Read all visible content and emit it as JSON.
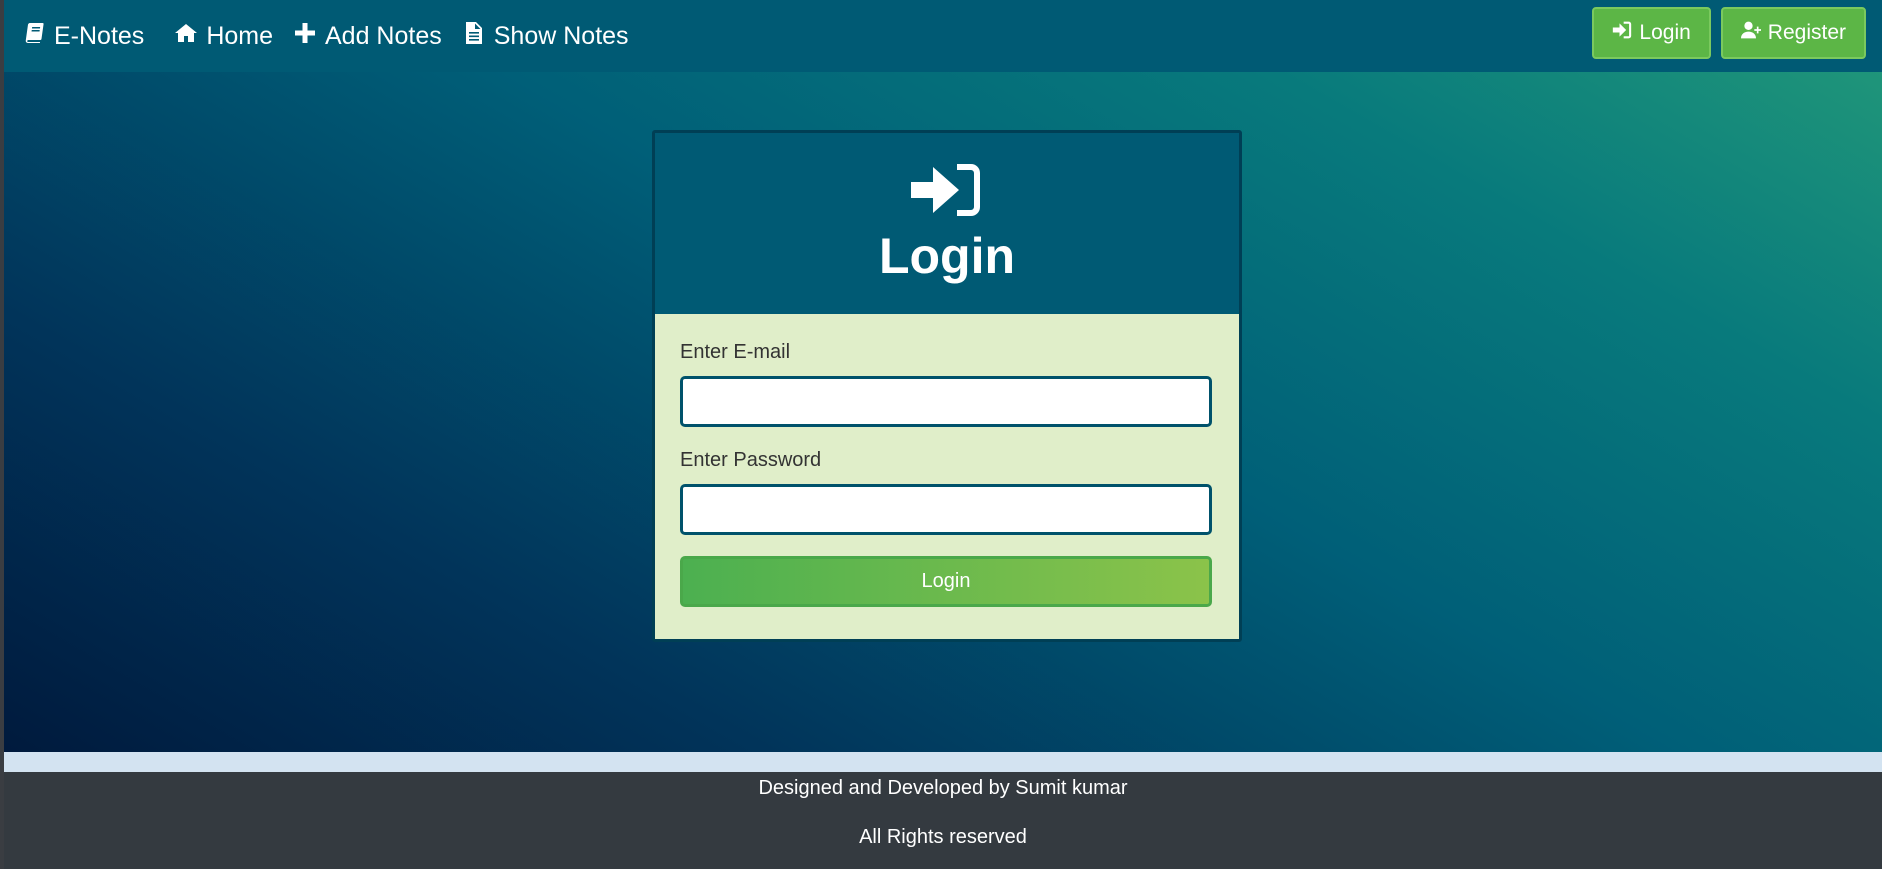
{
  "navbar": {
    "brand": "E-Notes",
    "links": [
      "Home",
      "Add Notes",
      "Show Notes"
    ],
    "login_label": "Login",
    "register_label": "Register"
  },
  "card": {
    "title": "Login",
    "email_label": "Enter E-mail",
    "email_value": "",
    "password_label": "Enter Password",
    "password_value": "",
    "submit_label": "Login"
  },
  "footer": {
    "credit": "Designed and Developed by Sumit kumar",
    "rights": "All Rights reserved"
  },
  "colors": {
    "navbar": "#005a74",
    "button_green": "#5cb646",
    "card_body": "#e0eec9",
    "footer": "#343a40"
  },
  "icons": {
    "brand": "book-icon",
    "home": "home-icon",
    "add": "plus-icon",
    "show": "file-icon",
    "login": "sign-in-icon",
    "register": "user-plus-icon"
  }
}
